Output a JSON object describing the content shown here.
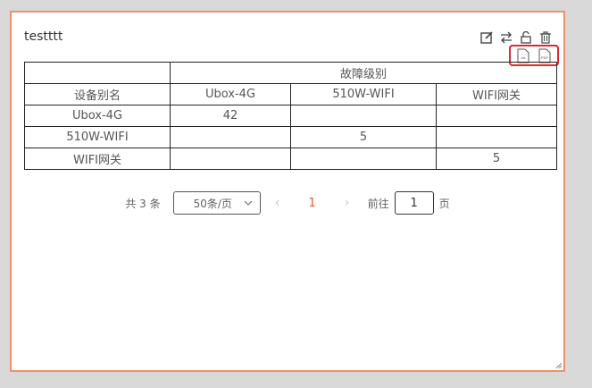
{
  "widget": {
    "title": "testttt",
    "toolbar": {
      "edit_icon": "edit-icon",
      "swap_icon": "swap-icon",
      "unlock_icon": "unlock-icon",
      "delete_icon": "trash-icon"
    },
    "export": {
      "xls_label": "xls",
      "pdf_label": "PDF"
    }
  },
  "table": {
    "group_header": "故障级别",
    "row_header": "设备别名",
    "columns": [
      "Ubox-4G",
      "510W-WIFI",
      "WIFI网关"
    ],
    "rows": [
      {
        "name": "Ubox-4G",
        "cells": [
          "42",
          "",
          ""
        ]
      },
      {
        "name": "510W-WIFI",
        "cells": [
          "",
          "5",
          ""
        ]
      },
      {
        "name": "WIFI网关",
        "cells": [
          "",
          "",
          "5"
        ]
      }
    ]
  },
  "pagination": {
    "total_label": "共 3 条",
    "page_size": "50条/页",
    "prev": "‹",
    "next": "›",
    "current_page": "1",
    "goto_label": "前往",
    "goto_value": "1",
    "page_suffix": "页"
  },
  "colors": {
    "card_border": "#f0906a",
    "highlight": "#e02a2a",
    "active_page": "#e8572a"
  }
}
